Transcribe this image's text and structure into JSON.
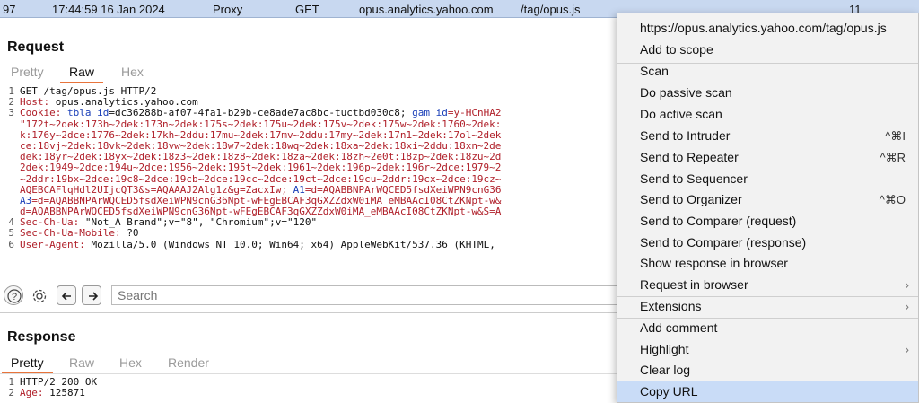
{
  "history_row": {
    "number": "97",
    "time": "17:44:59 16 Jan 2024",
    "tool": "Proxy",
    "method": "GET",
    "host": "opus.analytics.yahoo.com",
    "path": "/tag/opus.js",
    "count": "11"
  },
  "request": {
    "title": "Request",
    "tabs": [
      "Pretty",
      "Raw",
      "Hex"
    ],
    "active_tab": "Raw",
    "lines": [
      {
        "n": "1",
        "segments": [
          {
            "t": "tx",
            "v": "GET /tag/opus.js HTTP/2"
          }
        ]
      },
      {
        "n": "2",
        "segments": [
          {
            "t": "hn",
            "v": "Host: "
          },
          {
            "t": "tx",
            "v": "opus.analytics.yahoo.com"
          }
        ]
      },
      {
        "n": "3",
        "segments": [
          {
            "t": "hn",
            "v": "Cookie: "
          },
          {
            "t": "ck",
            "v": "tbla_id"
          },
          {
            "t": "tx",
            "v": "=dc36288b-af07-4fa1-b29b-ce8ade7ac8bc-tuctbd030c8; "
          },
          {
            "t": "ck",
            "v": "gam_id"
          },
          {
            "t": "rv",
            "v": "=y-HCnHA2"
          }
        ]
      },
      {
        "n": "",
        "segments": [
          {
            "t": "rv",
            "v": "\"172t~2dek:173h~2dek:173n~2dek:175s~2dek:175u~2dek:175v~2dek:175w~2dek:1760~2dek:"
          }
        ]
      },
      {
        "n": "",
        "segments": [
          {
            "t": "rv",
            "v": "k:176y~2dce:1776~2dek:17kh~2ddu:17mu~2dek:17mv~2ddu:17my~2dek:17n1~2dek:17ol~2dek"
          }
        ]
      },
      {
        "n": "",
        "segments": [
          {
            "t": "rv",
            "v": "ce:18vj~2dek:18vk~2dek:18vw~2dek:18w7~2dek:18wq~2dek:18xa~2dek:18xi~2ddu:18xn~2de"
          }
        ]
      },
      {
        "n": "",
        "segments": [
          {
            "t": "rv",
            "v": "dek:18yr~2dek:18yx~2dek:18z3~2dek:18z8~2dek:18za~2dek:18zh~2e0t:18zp~2dek:18zu~2d"
          }
        ]
      },
      {
        "n": "",
        "segments": [
          {
            "t": "rv",
            "v": "2dek:1949~2dce:194u~2dce:1956~2dek:195t~2dek:1961~2dek:196p~2dek:196r~2dce:1979~2"
          }
        ]
      },
      {
        "n": "",
        "segments": [
          {
            "t": "rv",
            "v": "~2ddr:19bx~2dce:19c8~2dce:19cb~2dce:19cc~2dce:19ct~2dce:19cu~2ddr:19cx~2dce:19cz~"
          }
        ]
      },
      {
        "n": "",
        "segments": [
          {
            "t": "rv",
            "v": "AQEBCAFlqHdl2UIjcQT3&s=AQAAAJ2Alg1z&g=ZacxIw; "
          },
          {
            "t": "ck",
            "v": "A1"
          },
          {
            "t": "rv",
            "v": "=d=AQABBNPArWQCED5fsdXeiWPN9cnG36"
          }
        ]
      },
      {
        "n": "",
        "segments": [
          {
            "t": "ck",
            "v": "A3"
          },
          {
            "t": "rv",
            "v": "=d=AQABBNPArWQCED5fsdXeiWPN9cnG36Npt-wFEgEBCAF3qGXZZdxW0iMA_eMBAAcI08CtZKNpt-w&"
          }
        ]
      },
      {
        "n": "",
        "segments": [
          {
            "t": "rv",
            "v": "d=AQABBNPArWQCED5fsdXeiWPN9cnG36Npt-wFEgEBCAF3qGXZZdxW0iMA_eMBAAcI08CtZKNpt-w&S=A"
          }
        ]
      },
      {
        "n": "4",
        "segments": [
          {
            "t": "hn",
            "v": "Sec-Ch-Ua: "
          },
          {
            "t": "tx",
            "v": "\"Not_A Brand\";v=\"8\", \"Chromium\";v=\"120\""
          }
        ]
      },
      {
        "n": "5",
        "segments": [
          {
            "t": "hn",
            "v": "Sec-Ch-Ua-Mobile: "
          },
          {
            "t": "tx",
            "v": "?0"
          }
        ]
      },
      {
        "n": "6",
        "segments": [
          {
            "t": "hn",
            "v": "User-Agent: "
          },
          {
            "t": "tx",
            "v": "Mozilla/5.0 (Windows NT 10.0; Win64; x64) AppleWebKit/537.36 (KHTML,"
          }
        ]
      }
    ],
    "search_placeholder": "Search"
  },
  "response": {
    "title": "Response",
    "tabs": [
      "Pretty",
      "Raw",
      "Hex",
      "Render"
    ],
    "active_tab": "Pretty",
    "lines": [
      {
        "n": "1",
        "segments": [
          {
            "t": "tx",
            "v": "HTTP/2 200 OK"
          }
        ]
      },
      {
        "n": "2",
        "segments": [
          {
            "t": "hn",
            "v": "Age: "
          },
          {
            "t": "tx",
            "v": "125871"
          }
        ]
      }
    ]
  },
  "context_menu": {
    "url": "https://opus.analytics.yahoo.com/tag/opus.js",
    "add_to_scope": "Add to scope",
    "scan": "Scan",
    "passive_scan": "Do passive scan",
    "active_scan": "Do active scan",
    "send_intruder": "Send to Intruder",
    "send_intruder_shortcut": "^⌘I",
    "send_repeater": "Send to Repeater",
    "send_repeater_shortcut": "^⌘R",
    "send_sequencer": "Send to Sequencer",
    "send_organizer": "Send to Organizer",
    "send_organizer_shortcut": "^⌘O",
    "comparer_request": "Send to Comparer (request)",
    "comparer_response": "Send to Comparer (response)",
    "show_response": "Show response in browser",
    "request_in_browser": "Request in browser",
    "extensions": "Extensions",
    "add_comment": "Add comment",
    "highlight": "Highlight",
    "clear_log": "Clear log",
    "copy_url": "Copy URL",
    "submenu_arrow": "›"
  },
  "colors": {
    "row_highlight": "#c8d8f0",
    "header_name": "#b0202a",
    "cookie_name": "#1a3fb8",
    "active_tab_underline": "#e8743b",
    "menu_selection": "#c9dcf7"
  }
}
